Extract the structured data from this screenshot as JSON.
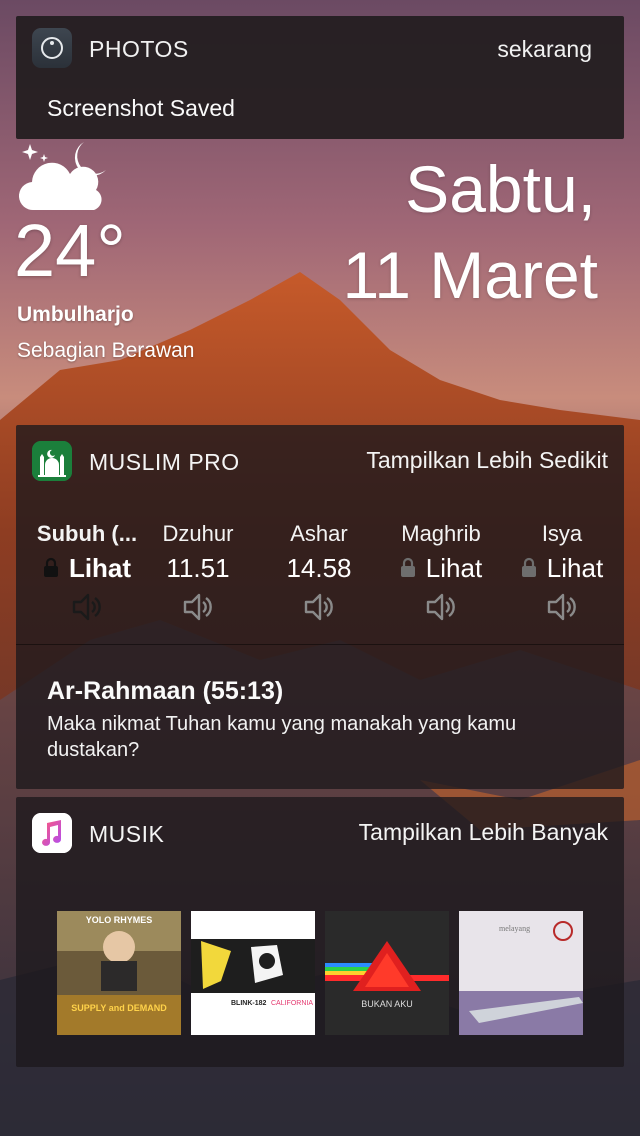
{
  "notification": {
    "app_name": "PHOTOS",
    "time": "sekarang",
    "message": "Screenshot Saved",
    "icon": "photos-app-icon"
  },
  "weather": {
    "icon": "partly-cloudy-night-icon",
    "temperature": "24°",
    "location": "Umbulharjo",
    "condition": "Sebagian Berawan"
  },
  "date": {
    "day": "Sabtu,",
    "date": "11 Maret"
  },
  "muslim_pro": {
    "app_name": "MUSLIM PRO",
    "toggle_label": "Tampilkan Lebih Sedikit",
    "icon": "muslim-pro-mosque-icon",
    "prayers": [
      {
        "name": "Subuh (...",
        "time": "Lihat",
        "locked": true,
        "active": true
      },
      {
        "name": "Dzuhur",
        "time": "11.51",
        "locked": false,
        "active": false
      },
      {
        "name": "Ashar",
        "time": "14.58",
        "locked": false,
        "active": false
      },
      {
        "name": "Maghrib",
        "time": "Lihat",
        "locked": true,
        "active": false
      },
      {
        "name": "Isya",
        "time": "Lihat",
        "locked": true,
        "active": false
      }
    ],
    "verse": {
      "title": "Ar-Rahmaan (55:13)",
      "text": "Maka nikmat Tuhan kamu yang manakah yang kamu dustakan?"
    }
  },
  "musik": {
    "app_name": "MUSIK",
    "toggle_label": "Tampilkan Lebih Banyak",
    "icon": "music-app-icon",
    "albums": [
      {
        "name": "album-yolo-rhymes",
        "art_text": "YOLO RHYMES",
        "art_text2": "SUPPLY and DEMAND"
      },
      {
        "name": "album-blink-182-california",
        "art_text": "BLINK-182",
        "art_text2": "CALIFORNIA"
      },
      {
        "name": "album-bukan-aku",
        "art_text": "BUKAN AKU"
      },
      {
        "name": "album-melayang",
        "art_text": "melayang"
      }
    ]
  },
  "colors": {
    "widget_bg": "#1c181c",
    "muslim_green": "#1b7f3b",
    "locked_text": "#e0e0e0",
    "active_speaker": "#1a1a1a",
    "inactive_speaker": "#8a8a8a"
  }
}
